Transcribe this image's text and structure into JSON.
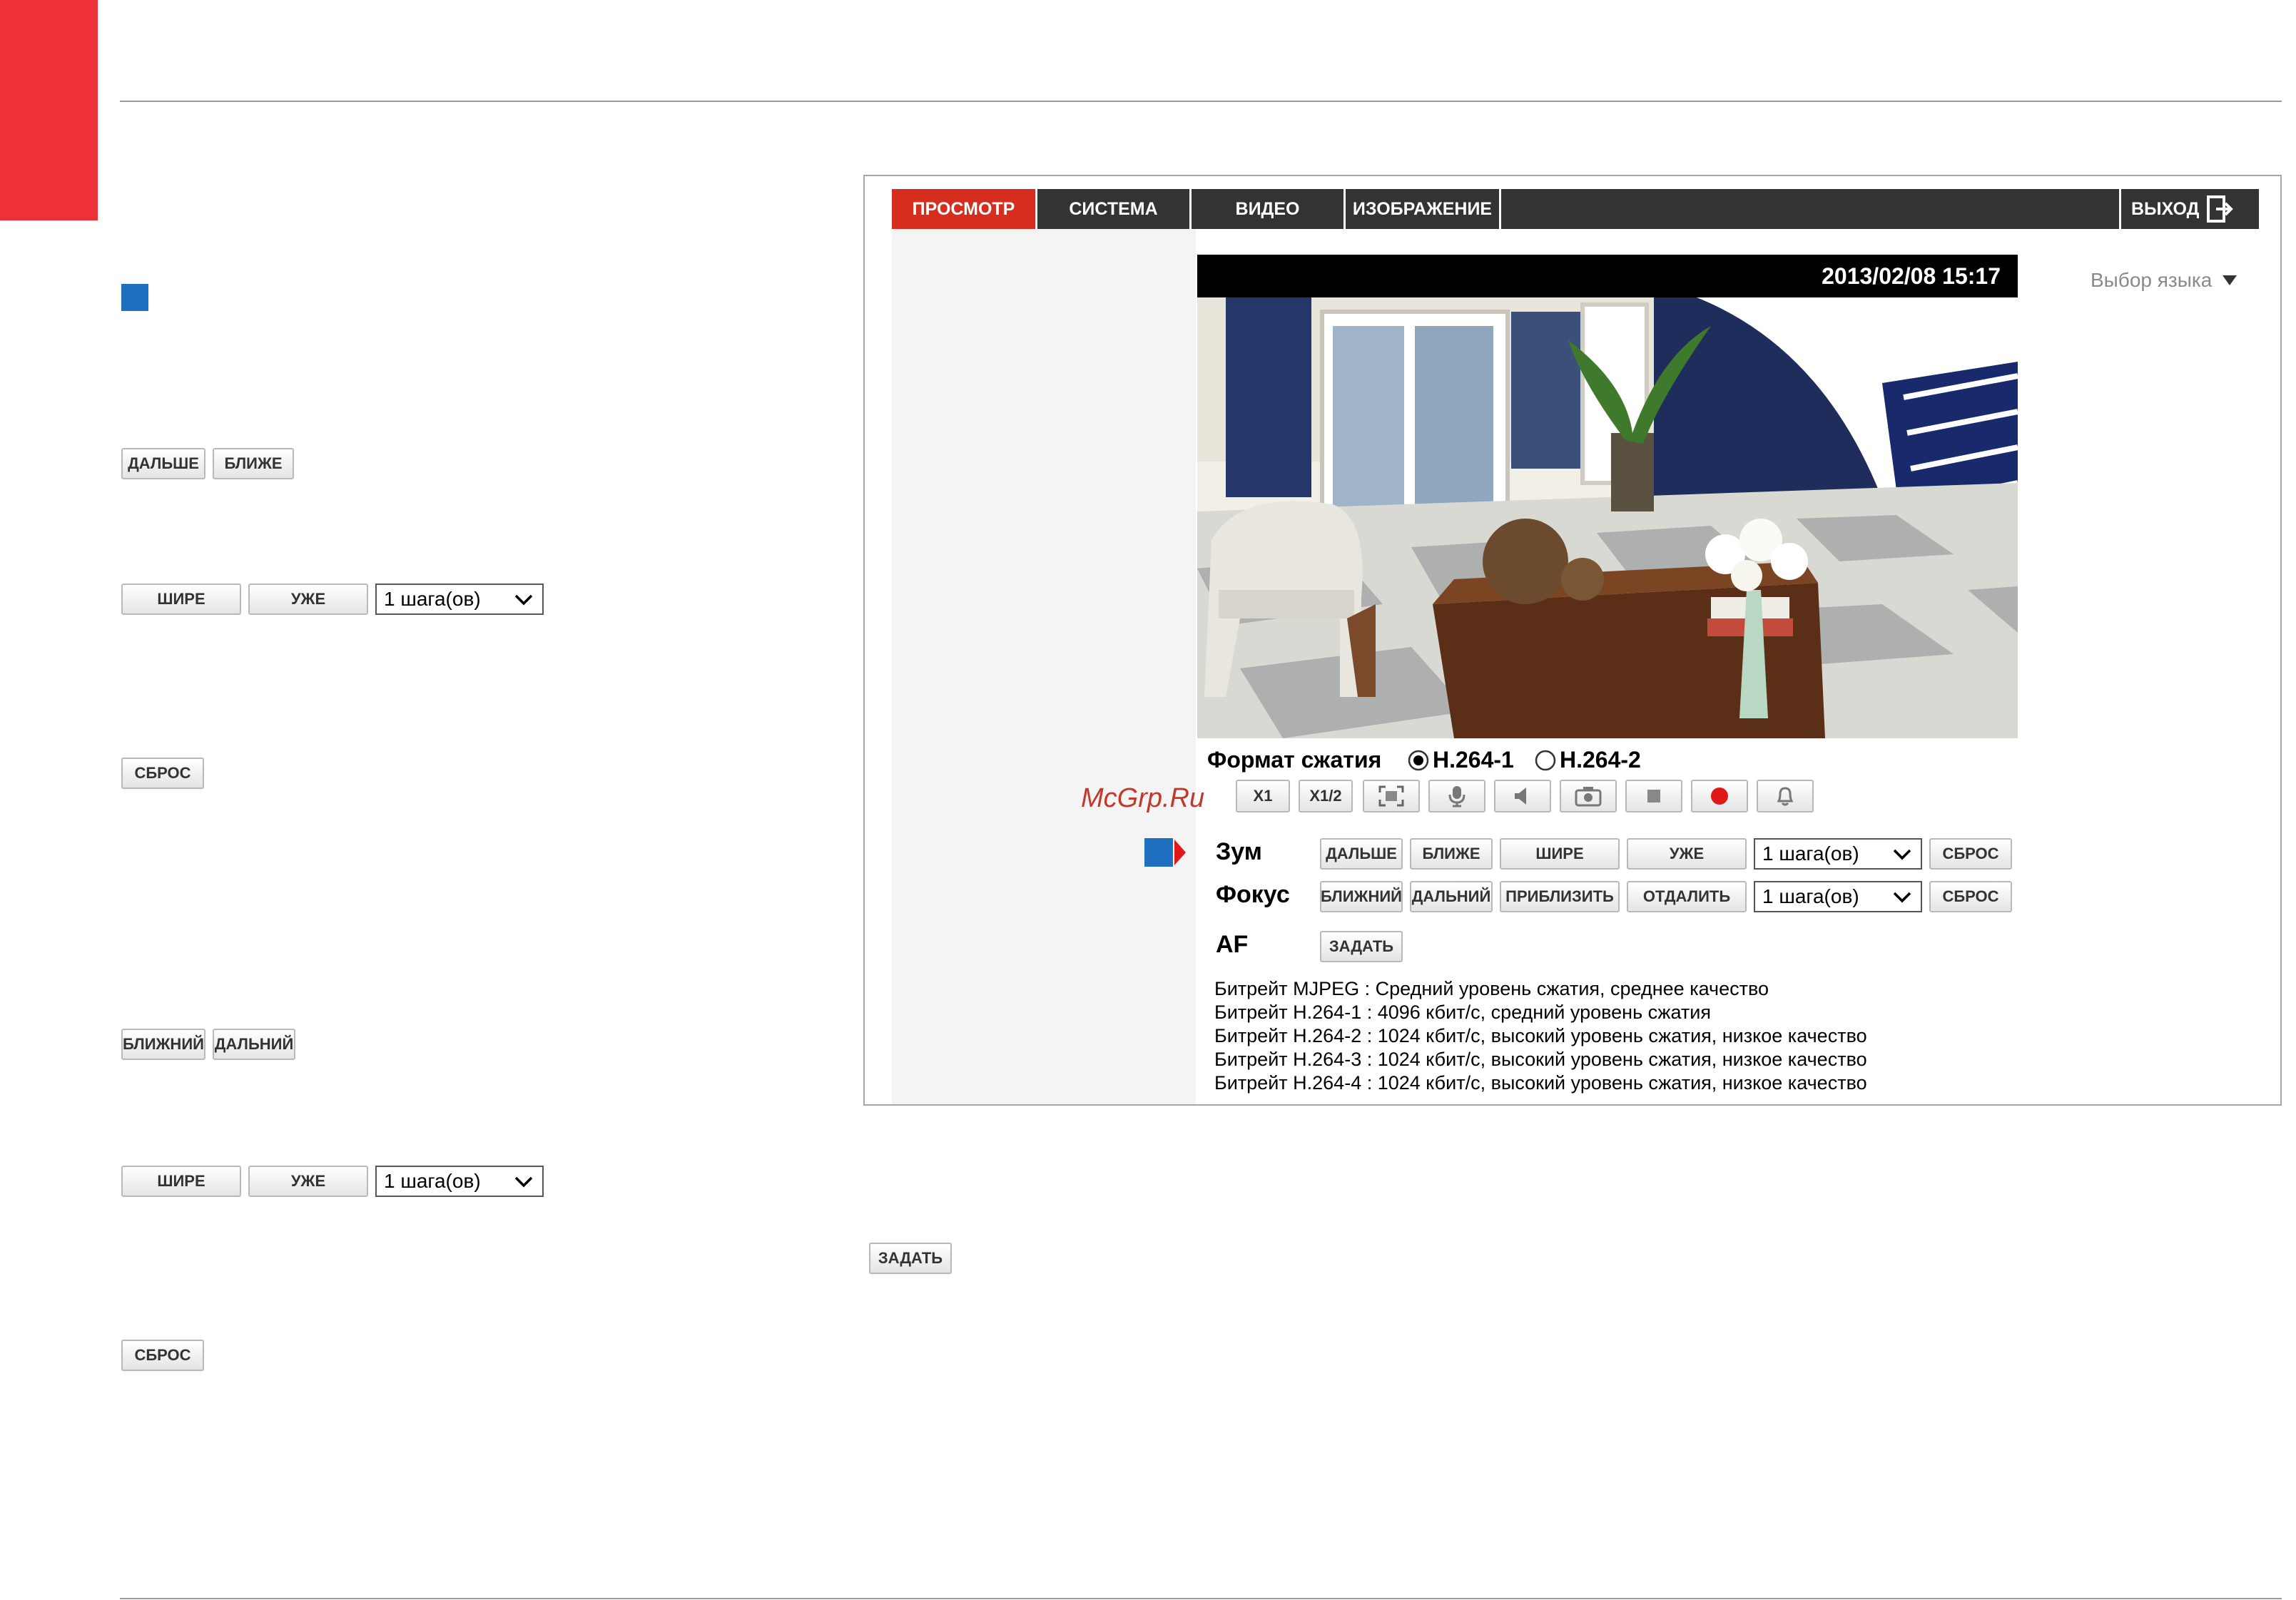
{
  "left_column": {
    "zoom_buttons": {
      "farther": "ДАЛЬШЕ",
      "closer": "БЛИЖЕ"
    },
    "zoom_step": {
      "wider": "ШИРЕ",
      "narrower": "УЖЕ",
      "step_value": "1 шага(ов)"
    },
    "zoom_reset": "СБРОС",
    "focus_buttons": {
      "near": "БЛИЖНИЙ",
      "far": "ДАЛЬНИЙ"
    },
    "focus_step": {
      "wider": "ШИРЕ",
      "narrower": "УЖЕ",
      "step_value": "1 шага(ов)"
    },
    "focus_reset": "СБРОС",
    "af_set": "ЗАДАТЬ"
  },
  "screenshot": {
    "nav": {
      "tabs": [
        "ПРОСМОТР",
        "СИСТЕМА",
        "ВИДЕО",
        "ИЗОБРАЖЕНИЕ"
      ],
      "active": "ПРОСМОТР",
      "exit": "ВЫХОД"
    },
    "language_select": "Выбор языка",
    "timestamp": "2013/02/08 15:17",
    "compression": {
      "label": "Формат сжатия",
      "options": [
        "H.264-1",
        "H.264-2"
      ],
      "selected": "H.264-1"
    },
    "toolbar": {
      "x1": "X1",
      "x1_2": "X1/2",
      "icons": [
        "fullscreen-icon",
        "microphone-icon",
        "speaker-icon",
        "snapshot-icon",
        "stop-icon",
        "record-icon",
        "alarm-bell-icon"
      ]
    },
    "zoom": {
      "label": "Зум",
      "farther": "ДАЛЬШЕ",
      "closer": "БЛИЖЕ",
      "wider": "ШИРЕ",
      "narrower": "УЖЕ",
      "step_value": "1 шага(ов)",
      "reset": "СБРОС"
    },
    "focus": {
      "label": "Фокус",
      "near": "БЛИЖНИЙ",
      "far": "ДАЛЬНИЙ",
      "approach": "ПРИБЛИЗИТЬ",
      "distance": "ОТДАЛИТЬ",
      "step_value": "1 шага(ов)",
      "reset": "СБРОС"
    },
    "af": {
      "label": "AF",
      "set": "ЗАДАТЬ"
    },
    "bitrates": [
      "Битрейт MJPEG : Средний уровень сжатия, среднее качество",
      "Битрейт H.264-1 : 4096 кбит/с, средний уровень сжатия",
      "Битрейт H.264-2 : 1024 кбит/с, высокий уровень сжатия, низкое качество",
      "Битрейт H.264-3 : 1024 кбит/с, высокий уровень сжатия, низкое качество",
      "Битрейт H.264-4 : 1024 кбит/с, высокий уровень сжатия, низкое качество"
    ]
  },
  "watermark": "McGrp.Ru",
  "colors": {
    "brand_red": "#ee3137",
    "nav_active": "#d62d1e",
    "nav_bg": "#333333",
    "marker_blue": "#1e6fbf"
  }
}
